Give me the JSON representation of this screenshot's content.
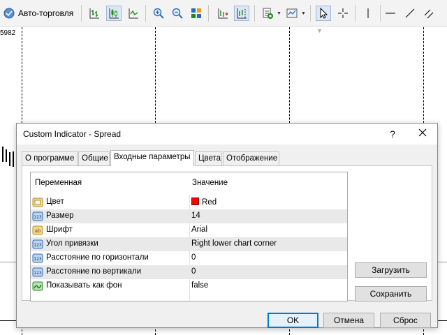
{
  "toolbar": {
    "auto_trading_label": "Авто-торговля"
  },
  "chart": {
    "price_label": "5982"
  },
  "dialog": {
    "title": "Custom Indicator - Spread",
    "help_label": "?",
    "tabs": [
      {
        "label": "О программе"
      },
      {
        "label": "Общие"
      },
      {
        "label": "Входные параметры"
      },
      {
        "label": "Цвета"
      },
      {
        "label": "Отображение"
      }
    ],
    "active_tab": "Входные параметры",
    "grid": {
      "col_variable": "Переменная",
      "col_value": "Значение",
      "rows": [
        {
          "variable": "Цвет",
          "value": "Red",
          "icon": "color-param-icon"
        },
        {
          "variable": "Размер",
          "value": "14",
          "icon": "number-param-icon"
        },
        {
          "variable": "Шрифт",
          "value": "Arial",
          "icon": "text-param-icon"
        },
        {
          "variable": "Угол привязки",
          "value": "Right lower chart corner",
          "icon": "number-param-icon"
        },
        {
          "variable": "Расстояние по горизонтали",
          "value": "0",
          "icon": "number-param-icon"
        },
        {
          "variable": "Расстояние по вертикали",
          "value": "0",
          "icon": "number-param-icon"
        },
        {
          "variable": "Показывать как фон",
          "value": "false",
          "icon": "bool-param-icon"
        }
      ]
    },
    "buttons": {
      "load": "Загрузить",
      "save": "Сохранить",
      "ok": "OK",
      "cancel": "Отмена",
      "reset": "Сброс"
    },
    "colors": {
      "swatch_red": "#ff0000",
      "default_button_border": "#0078d7"
    }
  }
}
